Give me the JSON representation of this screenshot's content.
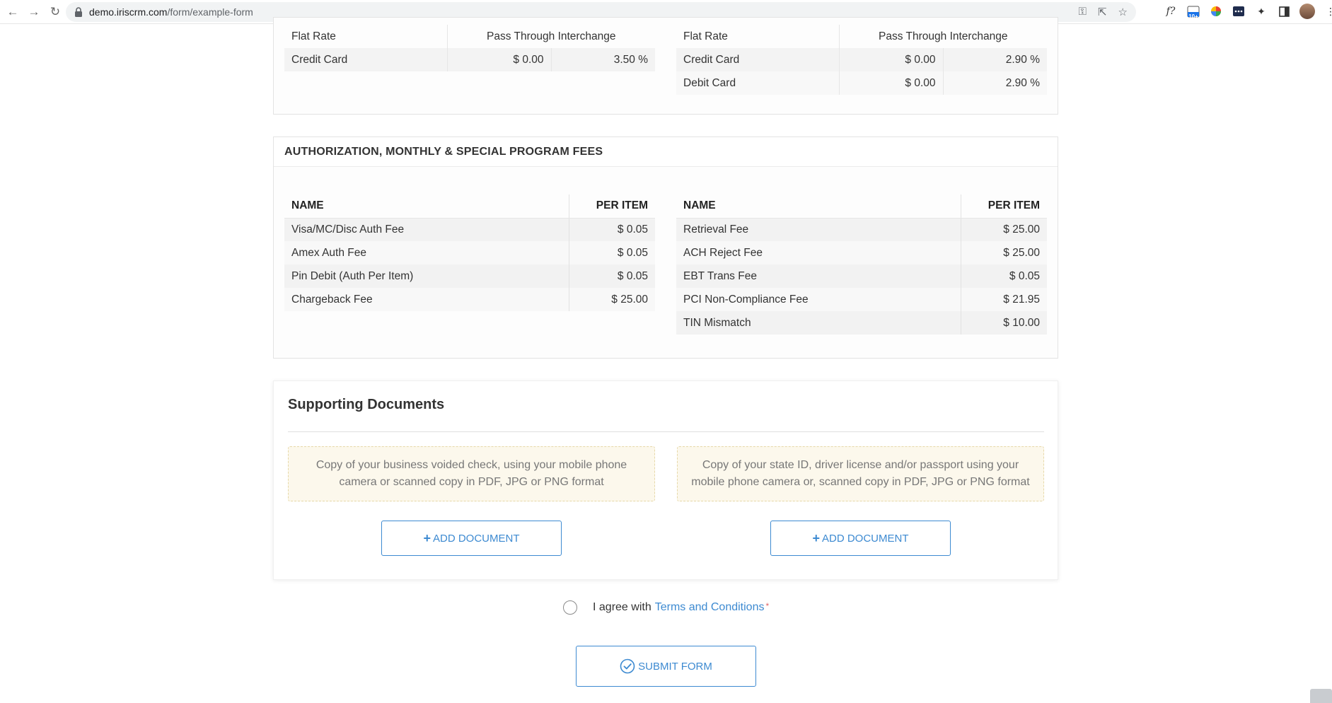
{
  "browser": {
    "url_host": "demo.iriscrm.com",
    "url_path": "/form/example-form",
    "ext_badge": "10+"
  },
  "rates": {
    "left": {
      "header_label": "Flat Rate",
      "header_span": "Pass Through Interchange",
      "rows": [
        {
          "name": "Credit Card",
          "fee": "$ 0.00",
          "rate": "3.50 %"
        }
      ]
    },
    "right": {
      "header_label": "Flat Rate",
      "header_span": "Pass Through Interchange",
      "rows": [
        {
          "name": "Credit Card",
          "fee": "$ 0.00",
          "rate": "2.90 %"
        },
        {
          "name": "Debit Card",
          "fee": "$ 0.00",
          "rate": "2.90 %"
        }
      ]
    }
  },
  "fees": {
    "title": "AUTHORIZATION, MONTHLY & SPECIAL PROGRAM FEES",
    "col_name": "NAME",
    "col_per_item": "PER ITEM",
    "left_rows": [
      {
        "name": "Visa/MC/Disc Auth Fee",
        "value": "$ 0.05"
      },
      {
        "name": "Amex Auth Fee",
        "value": "$ 0.05"
      },
      {
        "name": "Pin Debit (Auth Per Item)",
        "value": "$ 0.05"
      },
      {
        "name": "Chargeback Fee",
        "value": "$ 25.00"
      }
    ],
    "right_rows": [
      {
        "name": "Retrieval Fee",
        "value": "$ 25.00"
      },
      {
        "name": "ACH Reject Fee",
        "value": "$ 25.00"
      },
      {
        "name": "EBT Trans Fee",
        "value": "$ 0.05"
      },
      {
        "name": "PCI Non-Compliance Fee",
        "value": "$ 21.95"
      },
      {
        "name": "TIN Mismatch",
        "value": "$ 10.00"
      }
    ]
  },
  "documents": {
    "title": "Supporting Documents",
    "note_left": "Copy of your business voided check, using your mobile phone camera or scanned copy in PDF, JPG or PNG format",
    "note_right": "Copy of your state ID, driver license and/or passport using your mobile phone camera or, scanned copy in PDF, JPG or PNG format",
    "add_label": "ADD DOCUMENT"
  },
  "agreement": {
    "prefix": "I agree with",
    "link": "Terms and Conditions",
    "required_mark": "*"
  },
  "submit_label": "SUBMIT FORM",
  "colors": {
    "accent": "#3d8ad1",
    "note_bg": "#fcf8ec",
    "note_border": "#e6d8a8"
  }
}
